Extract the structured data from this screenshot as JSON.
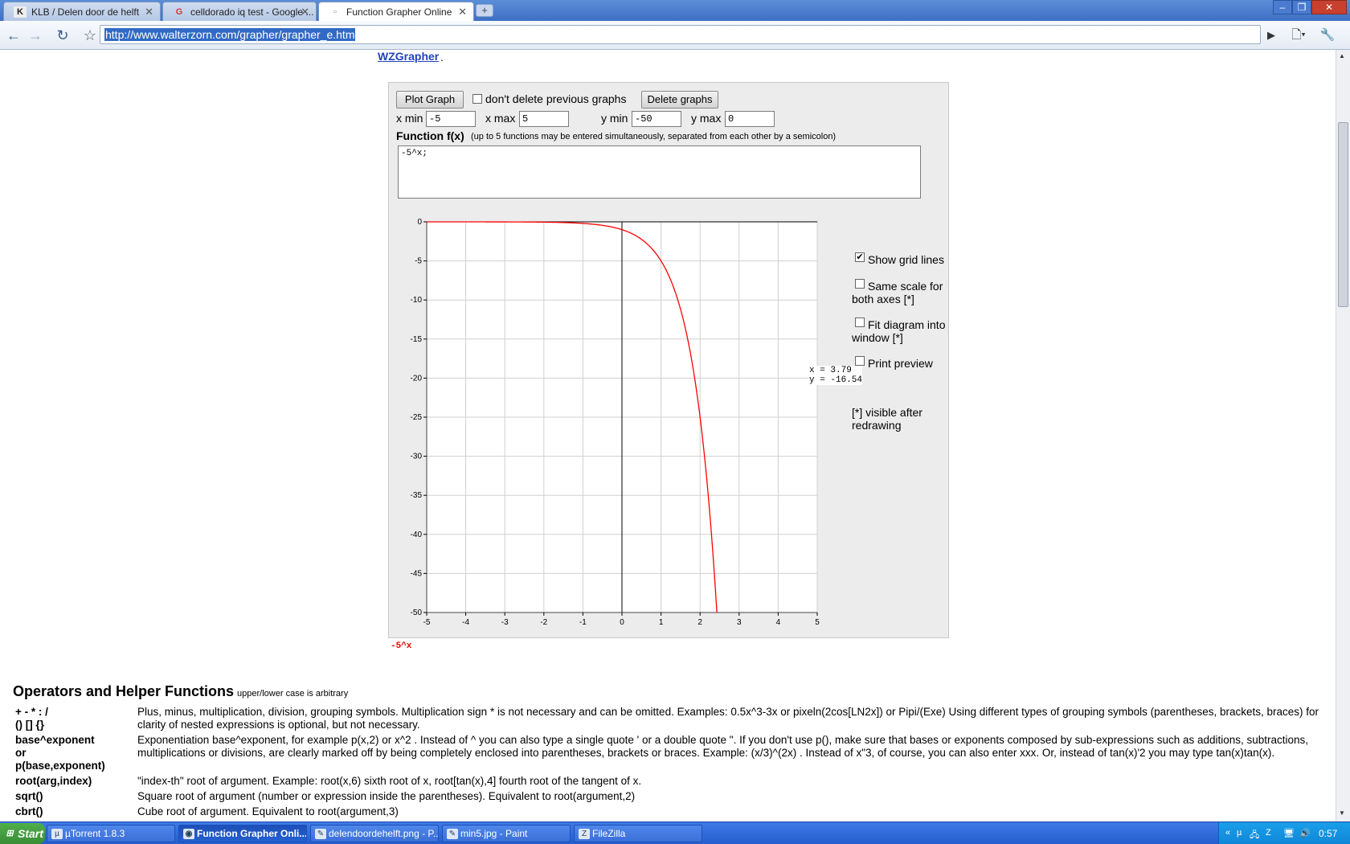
{
  "browser": {
    "tabs": [
      {
        "title": "KLB / Delen door de helft",
        "icon": "klb-favicon",
        "icon_text": "K"
      },
      {
        "title": "celldorado iq test - Google ...",
        "icon": "google-favicon",
        "icon_text": "G"
      },
      {
        "title": "Function Grapher Online",
        "icon": "page-icon",
        "icon_text": "▫"
      }
    ],
    "url": "http://www.walterzorn.com/grapher/grapher_e.htm"
  },
  "page": {
    "link": "WZGrapher",
    "link_suffix": ".",
    "plot_button": "Plot Graph",
    "keep_label": "don't delete previous graphs",
    "keep_checked": false,
    "delete_button": "Delete graphs",
    "xmin_label": "x min",
    "xmin": "-5",
    "xmax_label": "x max",
    "xmax": "5",
    "ymin_label": "y min",
    "ymin": "-50",
    "ymax_label": "y max",
    "ymax": "0",
    "function_label": "Function f(x)",
    "function_hint": "(up to 5 functions may be entered simultaneously, separated from each other by a semicolon)",
    "function_value": "-5^x;",
    "readout_x": "x = 3.79",
    "readout_y": "y = -16.54",
    "options": {
      "grid_label": "Show grid lines",
      "grid_checked": true,
      "same_scale_label_1": "Same scale for",
      "same_scale_label_2": "both axes [*]",
      "fit_label_1": "Fit diagram into",
      "fit_label_2": "window [*]",
      "print_label": "Print preview",
      "note_1": "[*] visible after",
      "note_2": "redrawing"
    },
    "legend_label": "-5^x"
  },
  "chart_data": {
    "type": "line",
    "series": [
      {
        "name": "-5^x",
        "expression": "-5^x",
        "color": "#ff0000"
      }
    ],
    "xlim": [
      -5,
      5
    ],
    "ylim": [
      -50,
      0
    ],
    "x_ticks": [
      -5,
      -4,
      -3,
      -2,
      -1,
      0,
      1,
      2,
      3,
      4,
      5
    ],
    "y_ticks": [
      0,
      -5,
      -10,
      -15,
      -20,
      -25,
      -30,
      -35,
      -40,
      -45,
      -50
    ],
    "grid": true,
    "x": [
      -5,
      -2,
      -1,
      0,
      0.5,
      1,
      1.5,
      2,
      2.2,
      2.43
    ],
    "y": [
      -0.0003,
      -0.04,
      -0.2,
      -1,
      -2.24,
      -5,
      -11.18,
      -25,
      -34.49,
      -50
    ]
  },
  "operators": {
    "title": "Operators and Helper Functions",
    "subtitle": "upper/lower case is arbitrary",
    "rows": [
      {
        "key": "+ - * : /\n() [] {}",
        "desc": "Plus, minus, multiplication, division, grouping symbols. Multiplication sign * is not necessary and can be omitted. Examples: 0.5x^3-3x or pixeln(2cos[LN2x]) or Pipi/(Exe) Using different types of grouping symbols (parentheses, brackets, braces) for clarity of nested expressions is optional, but not necessary."
      },
      {
        "key": "base^exponent\nor\np(base,exponent)",
        "desc": "Exponentiation base^exponent, for example p(x,2) or x^2 . Instead of ^ you can also type a single quote ' or a double quote \". If you don't use p(), make sure that bases or exponents composed by sub-expressions such as additions, subtractions, multiplications or divisions, are clearly marked off by being completely enclosed into parentheses, brackets or braces. Example: (x/3)^(2x) . Instead of x\"3, of course, you can also enter xxx. Or, instead of tan(x)'2 you may type tan(x)tan(x)."
      },
      {
        "key": "root(arg,index)",
        "desc": "\"index-th\" root of argument. Example: root(x,6) sixth root of x, root[tan(x),4] fourth root of the tangent of x."
      },
      {
        "key": "sqrt()",
        "desc": "Square root of argument (number or expression inside the parentheses). Equivalent to root(argument,2)"
      },
      {
        "key": "cbrt()",
        "desc": "Cube root of argument. Equivalent to root(argument,3)"
      }
    ]
  },
  "taskbar": {
    "start": "Start",
    "tasks": [
      {
        "label": "µTorrent 1.8.3",
        "icon": "utorrent-icon",
        "icon_text": "µ"
      },
      {
        "label": "Function Grapher Onli...",
        "icon": "chrome-icon",
        "icon_text": "◉"
      },
      {
        "label": "delendoordehelft.png - P...",
        "icon": "paint-icon",
        "icon_text": "✎"
      },
      {
        "label": "min5.jpg - Paint",
        "icon": "paint-icon",
        "icon_text": "✎"
      },
      {
        "label": "FileZilla",
        "icon": "filezilla-icon",
        "icon_text": "Z"
      }
    ],
    "clock": "0:57"
  }
}
